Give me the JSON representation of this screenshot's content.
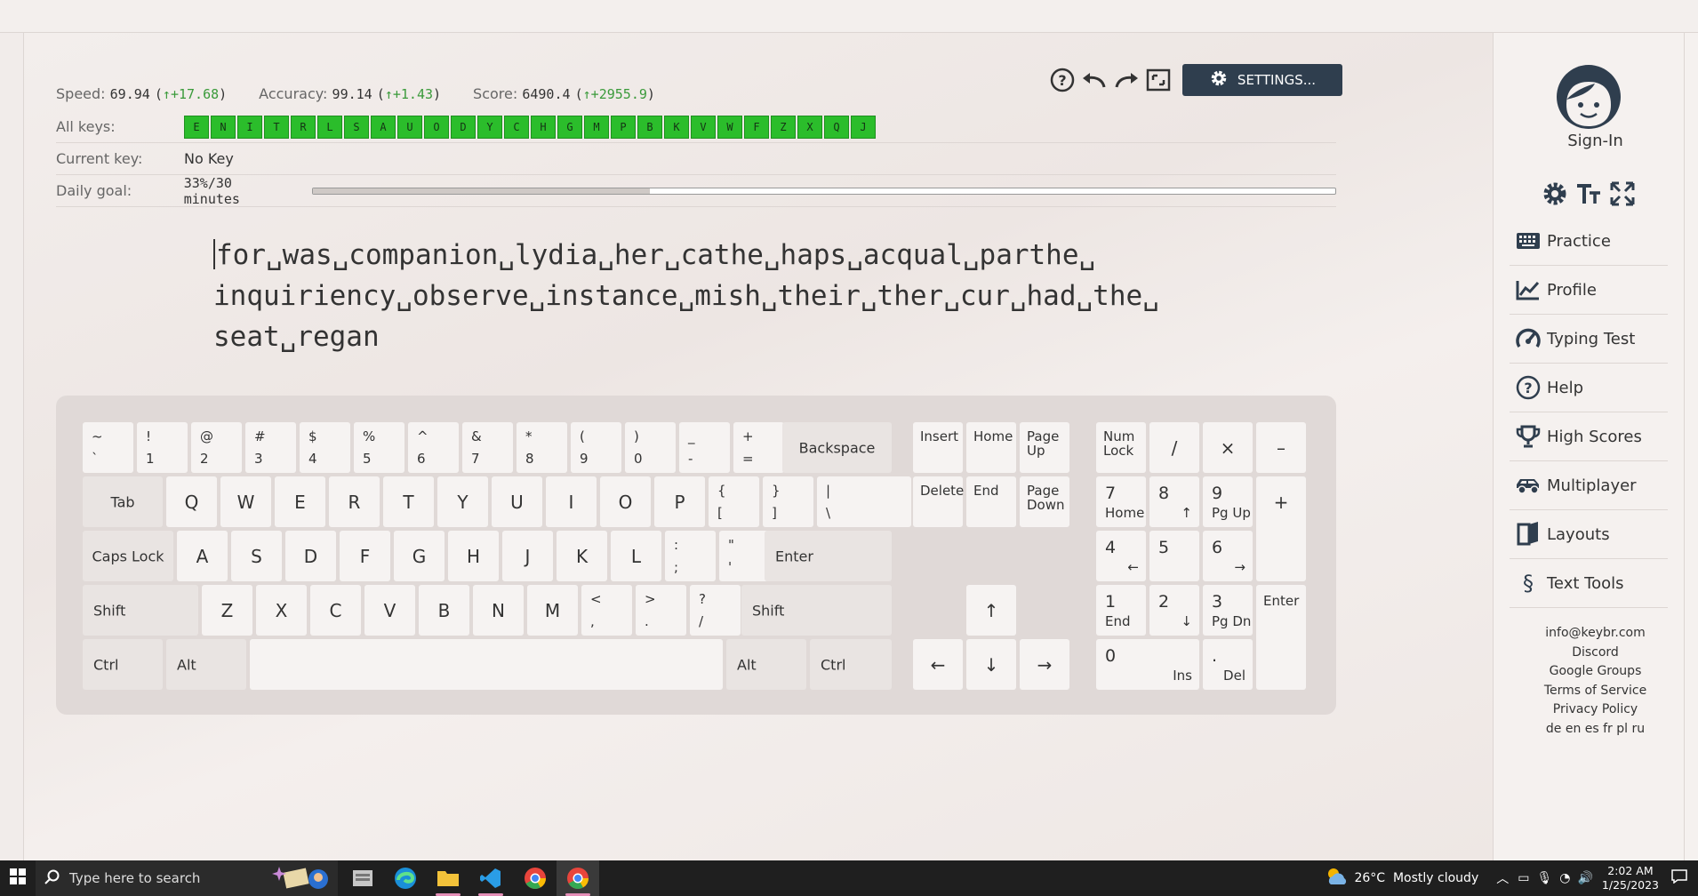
{
  "stats": {
    "speed_label": "Speed:",
    "speed_value": "69.94",
    "speed_delta": "↑+17.68",
    "accuracy_label": "Accuracy:",
    "accuracy_value": "99.14",
    "accuracy_delta": "↑+1.43",
    "score_label": "Score:",
    "score_value": "6490.4",
    "score_delta": "↑+2955.9"
  },
  "toolbar": {
    "settings_label": "SETTINGS..."
  },
  "all_keys": {
    "label": "All keys:",
    "keys": [
      "E",
      "N",
      "I",
      "T",
      "R",
      "L",
      "S",
      "A",
      "U",
      "O",
      "D",
      "Y",
      "C",
      "H",
      "G",
      "M",
      "P",
      "B",
      "K",
      "V",
      "W",
      "F",
      "Z",
      "X",
      "Q",
      "J"
    ],
    "color": "#2bbd2b"
  },
  "current_key": {
    "label": "Current key:",
    "value": "No Key"
  },
  "daily_goal": {
    "label": "Daily goal:",
    "value": "33%/30 minutes",
    "progress": 0.33
  },
  "practice_text": {
    "line1": "for␣was␣companion␣lydia␣her␣cathe␣haps␣acqual␣parthe␣",
    "line2": "inquiriency␣observe␣instance␣mish␣their␣ther␣cur␣had␣the␣",
    "line3": "seat␣regan"
  },
  "keyboard": {
    "row1": [
      [
        "~",
        "`"
      ],
      [
        "!",
        "1"
      ],
      [
        "@",
        "2"
      ],
      [
        "#",
        "3"
      ],
      [
        "$",
        "4"
      ],
      [
        "%",
        "5"
      ],
      [
        "^",
        "6"
      ],
      [
        "&",
        "7"
      ],
      [
        "*",
        "8"
      ],
      [
        "(",
        "9"
      ],
      [
        ")",
        "0"
      ],
      [
        "_",
        "-"
      ],
      [
        "+",
        "="
      ]
    ],
    "backspace": "Backspace",
    "tab": "Tab",
    "row2": [
      "Q",
      "W",
      "E",
      "R",
      "T",
      "Y",
      "U",
      "I",
      "O",
      "P"
    ],
    "row2_sym": [
      [
        "{",
        "["
      ],
      [
        "}",
        "]"
      ],
      [
        "|",
        "\\"
      ]
    ],
    "caps": "Caps Lock",
    "row3": [
      "A",
      "S",
      "D",
      "F",
      "G",
      "H",
      "J",
      "K",
      "L"
    ],
    "row3_sym": [
      [
        ":",
        ";"
      ],
      [
        "\"",
        "'"
      ]
    ],
    "enter": "Enter",
    "shift": "Shift",
    "row4": [
      "Z",
      "X",
      "C",
      "V",
      "B",
      "N",
      "M"
    ],
    "row4_sym": [
      [
        "<",
        ","
      ],
      [
        ">",
        "."
      ],
      [
        "?",
        "/"
      ]
    ],
    "ctrl": "Ctrl",
    "alt": "Alt",
    "insert": "Insert",
    "home": "Home",
    "page_up": "Page Up",
    "delete": "Delete",
    "end": "End",
    "page_down": "Page Down",
    "arrow_up": "↑",
    "arrow_left": "←",
    "arrow_down": "↓",
    "arrow_right": "→",
    "numlock": "Num Lock",
    "num_div": "/",
    "num_mul": "×",
    "num_minus": "–",
    "num_plus": "+",
    "num_enter": "Enter",
    "num7": [
      "7",
      "Home"
    ],
    "num8": [
      "8",
      "↑"
    ],
    "num9": [
      "9",
      "Pg Up"
    ],
    "num4": [
      "4",
      "←"
    ],
    "num5": "5",
    "num6": [
      "6",
      "→"
    ],
    "num1": [
      "1",
      "End"
    ],
    "num2": [
      "2",
      "↓"
    ],
    "num3": [
      "3",
      "Pg Dn"
    ],
    "num0": [
      "0",
      "Ins"
    ],
    "numdot": [
      ".",
      "Del"
    ]
  },
  "sidebar": {
    "signin": "Sign-In",
    "nav": [
      "Practice",
      "Profile",
      "Typing Test",
      "Help",
      "High Scores",
      "Multiplayer",
      "Layouts",
      "Text Tools"
    ],
    "links": [
      "info@keybr.com",
      "Discord",
      "Google Groups",
      "Terms of Service",
      "Privacy Policy",
      "de en es fr pl ru"
    ]
  },
  "taskbar": {
    "search_placeholder": "Type here to search",
    "weather": "26°C  Mostly cloudy",
    "time": "2:02 AM",
    "date": "1/25/2023"
  }
}
